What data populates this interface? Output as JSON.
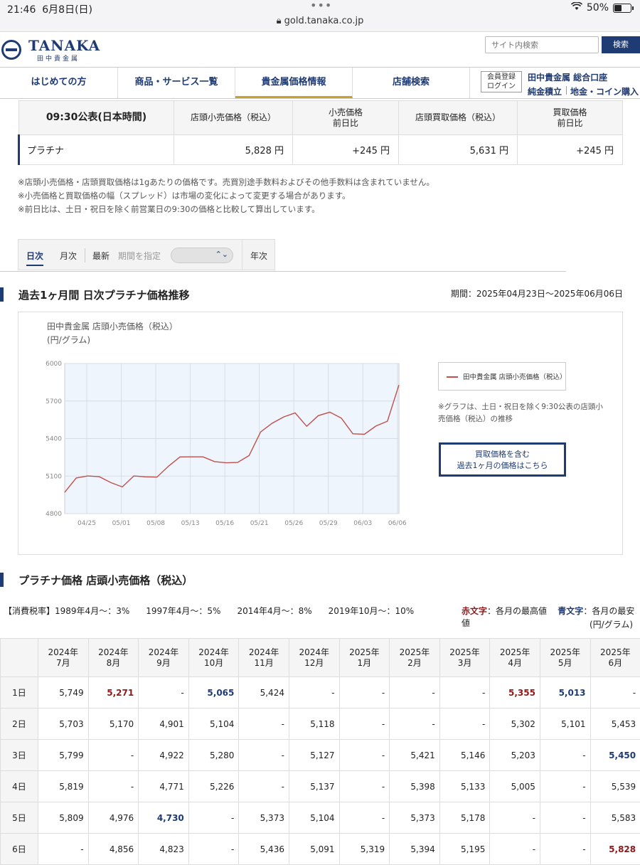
{
  "status_bar": {
    "time": "21:46",
    "date": "6月8日(日)",
    "url": "gold.tanaka.co.jp",
    "battery": "50%"
  },
  "header": {
    "logo": "TANAKA",
    "logo_sub": "田中貴金属",
    "search_placeholder": "サイト内検索",
    "search_button": "検索"
  },
  "nav": {
    "items": [
      "はじめての方",
      "商品・サービス一覧",
      "貴金属価格情報",
      "店舗検索"
    ],
    "login": [
      "会員登録",
      "ログイン"
    ],
    "links": [
      "田中貴金属 総合口座",
      "純金積立",
      "地金・コイン購入"
    ]
  },
  "price_table": {
    "headers": [
      "09:30公表(日本時間)",
      "店頭小売価格（税込）",
      "小売価格\n前日比",
      "店頭買取価格（税込）",
      "買取価格\n前日比"
    ],
    "row": [
      "プラチナ",
      "5,828 円",
      "+245 円",
      "5,631 円",
      "+245 円"
    ]
  },
  "notes": [
    "※店頭小売価格・店頭買取価格は1gあたりの価格です。売買別途手数料およびその他手数料は含まれていません。",
    "※小売価格と買取価格の幅（スプレッド）は市場の変化によって変更する場合があります。",
    "※前日比は、土日・祝日を除く前営業日の9:30の価格と比較して算出しています。"
  ],
  "tabs": {
    "daily": "日次",
    "monthly": "月次",
    "latest": "最新",
    "period_label": "期間を指定",
    "yearly": "年次"
  },
  "chart_section": {
    "heading": "過去1ヶ月間 日次プラチナ価格推移",
    "period": "期間：2025年04月23日〜2025年06月06日"
  },
  "chart_note": "※グラフは、土日・祝日を除く9:30公表の店頭小売価格（税込）の推移",
  "buy_button": [
    "買取価格を含む",
    "過去1ヶ月の価格はこちら"
  ],
  "chart_data": {
    "type": "line",
    "title": "田中貴金属 店頭小売価格（税込）",
    "ylabel": "(円/グラム)",
    "ylim": [
      4800,
      6000
    ],
    "yticks": [
      4800,
      5100,
      5400,
      5700,
      6000
    ],
    "xticks": [
      "04/25",
      "05/01",
      "05/08",
      "05/13",
      "05/16",
      "05/21",
      "05/26",
      "05/29",
      "06/03",
      "06/06"
    ],
    "legend": "田中貴金属 店頭小売価格（税込）",
    "grid": true,
    "series": [
      {
        "name": "田中貴金属 店頭小売価格（税込）",
        "values": [
          4970,
          5085,
          5101,
          5095,
          5048,
          5013,
          5101,
          5094,
          5092,
          5179,
          5253,
          5254,
          5254,
          5216,
          5206,
          5209,
          5264,
          5453,
          5522,
          5573,
          5605,
          5498,
          5583,
          5611,
          5563,
          5438,
          5434,
          5500,
          5539,
          5829
        ]
      }
    ]
  },
  "monthly_section": {
    "heading": "プラチナ価格 店頭小売価格（税込）"
  },
  "tax": {
    "label": "【消費税率】",
    "items": [
      "1989年4月〜：3%",
      "1997年4月〜：5%",
      "2014年4月〜：8%",
      "2019年10月〜：10%"
    ]
  },
  "legend_colors": {
    "red_label": "赤文字",
    "red_desc": "：各月の最高値",
    "blue_label": "青文字",
    "blue_desc": "：各月の最安値",
    "unit": "(円/グラム)",
    "red": "#8b1a1a",
    "blue": "#1f3b73"
  },
  "monthly_table": {
    "headers": [
      [
        "2024年",
        "7月"
      ],
      [
        "2024年",
        "8月"
      ],
      [
        "2024年",
        "9月"
      ],
      [
        "2024年",
        "10月"
      ],
      [
        "2024年",
        "11月"
      ],
      [
        "2024年",
        "12月"
      ],
      [
        "2025年",
        "1月"
      ],
      [
        "2025年",
        "2月"
      ],
      [
        "2025年",
        "3月"
      ],
      [
        "2025年",
        "4月"
      ],
      [
        "2025年",
        "5月"
      ],
      [
        "2025年",
        "6月"
      ]
    ],
    "rows": [
      {
        "day": "1日",
        "cells": [
          {
            "v": "5,749"
          },
          {
            "v": "5,271",
            "c": "red"
          },
          {
            "v": "-"
          },
          {
            "v": "5,065",
            "c": "blue"
          },
          {
            "v": "5,424"
          },
          {
            "v": "-"
          },
          {
            "v": "-"
          },
          {
            "v": "-"
          },
          {
            "v": "-"
          },
          {
            "v": "5,355",
            "c": "red"
          },
          {
            "v": "5,013",
            "c": "blue"
          },
          {
            "v": "-"
          }
        ]
      },
      {
        "day": "2日",
        "cells": [
          {
            "v": "5,703"
          },
          {
            "v": "5,170"
          },
          {
            "v": "4,901"
          },
          {
            "v": "5,104"
          },
          {
            "v": "-"
          },
          {
            "v": "5,118"
          },
          {
            "v": "-"
          },
          {
            "v": "-"
          },
          {
            "v": "-"
          },
          {
            "v": "5,302"
          },
          {
            "v": "5,101"
          },
          {
            "v": "5,453"
          }
        ]
      },
      {
        "day": "3日",
        "cells": [
          {
            "v": "5,799"
          },
          {
            "v": "-"
          },
          {
            "v": "4,922"
          },
          {
            "v": "5,280"
          },
          {
            "v": "-"
          },
          {
            "v": "5,127"
          },
          {
            "v": "-"
          },
          {
            "v": "5,421"
          },
          {
            "v": "5,146"
          },
          {
            "v": "5,203"
          },
          {
            "v": "-"
          },
          {
            "v": "5,450",
            "c": "blue"
          }
        ]
      },
      {
        "day": "4日",
        "cells": [
          {
            "v": "5,819"
          },
          {
            "v": "-"
          },
          {
            "v": "4,771"
          },
          {
            "v": "5,226"
          },
          {
            "v": "-"
          },
          {
            "v": "5,137"
          },
          {
            "v": "-"
          },
          {
            "v": "5,398"
          },
          {
            "v": "5,133"
          },
          {
            "v": "5,005"
          },
          {
            "v": "-"
          },
          {
            "v": "5,539"
          }
        ]
      },
      {
        "day": "5日",
        "cells": [
          {
            "v": "5,809"
          },
          {
            "v": "4,976"
          },
          {
            "v": "4,730",
            "c": "blue"
          },
          {
            "v": "-"
          },
          {
            "v": "5,373"
          },
          {
            "v": "5,104"
          },
          {
            "v": "-"
          },
          {
            "v": "5,373"
          },
          {
            "v": "5,178"
          },
          {
            "v": "-"
          },
          {
            "v": "-"
          },
          {
            "v": "5,583"
          }
        ]
      },
      {
        "day": "6日",
        "cells": [
          {
            "v": "-"
          },
          {
            "v": "4,856"
          },
          {
            "v": "4,823"
          },
          {
            "v": "-"
          },
          {
            "v": "5,436"
          },
          {
            "v": "5,091"
          },
          {
            "v": "5,319"
          },
          {
            "v": "5,394"
          },
          {
            "v": "5,195"
          },
          {
            "v": "-"
          },
          {
            "v": "-"
          },
          {
            "v": "5,828",
            "c": "red"
          }
        ]
      }
    ]
  }
}
